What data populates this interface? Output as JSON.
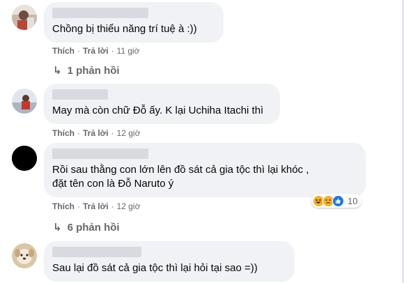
{
  "comments": [
    {
      "text": "Chồng bị thiểu năng trí tuệ à :))",
      "like_label": "Thích",
      "reply_label": "Trả lời",
      "time": "11 giờ",
      "replies_label": "1 phản hồi",
      "avatar_icon": "user-avatar-icon"
    },
    {
      "text": "May mà còn chữ Đỗ ấy. K lại Uchiha Itachi thì",
      "like_label": "Thích",
      "reply_label": "Trả lời",
      "time": "12 giờ",
      "avatar_icon": "user-avatar-icon"
    },
    {
      "text_line1": "Rồi sau thằng con lớn lên đồ sát cả gia tộc thì lại khóc ,",
      "text_line2": "đặt tên con là Đỗ Naruto ý",
      "like_label": "Thích",
      "reply_label": "Trả lời",
      "time": "12 giờ",
      "reaction_count": "10",
      "reaction_icons": [
        "haha-icon",
        "sad-icon",
        "like-icon"
      ],
      "replies_label": "6 phản hồi",
      "avatar_icon": "user-avatar-icon"
    },
    {
      "text": "Sau lại đồ sát cả gia tộc thì lại hỏi tại sao =))",
      "avatar_icon": "user-avatar-icon"
    }
  ],
  "colors": {
    "bubble": "#f0f2f5",
    "secondary_text": "#65676b",
    "like_blue": "#1877f2",
    "reaction_yellow": "#f7b125"
  }
}
